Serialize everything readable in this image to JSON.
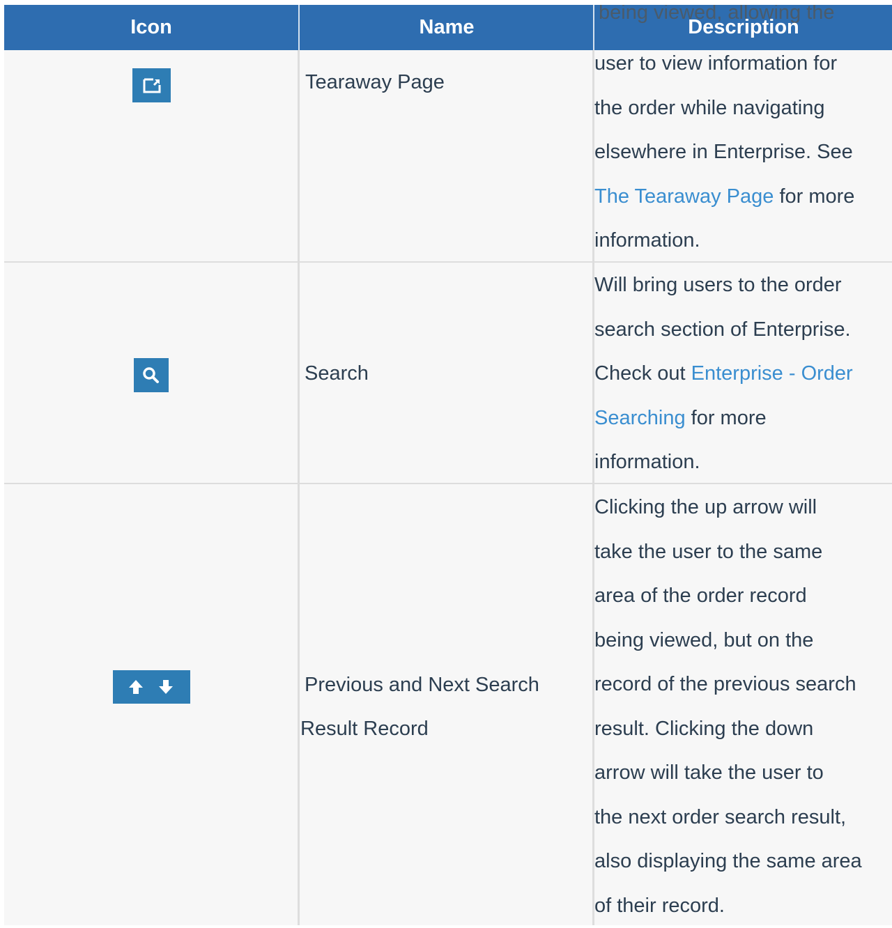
{
  "header": {
    "col_icon": "Icon",
    "col_name": "Name",
    "col_desc": "Description"
  },
  "row1": {
    "icon": "tearaway-icon",
    "name": "Tearaway Page",
    "desc_overflow": "being viewed, allowing the",
    "desc_lines": [
      "user to view information for",
      "the order while navigating",
      "elsewhere in Enterprise. See"
    ],
    "desc_link": "The Tearaway Page",
    "desc_after_link": " for more",
    "desc_last": "information."
  },
  "row2": {
    "icon": "search-icon",
    "name": "Search",
    "desc_l1": "Will bring users to the order",
    "desc_l2": "search section of Enterprise.",
    "desc_l3_pre": "Check out ",
    "desc_l3_link": "Enterprise - Order",
    "desc_l4_link": "Searching",
    "desc_l4_post": " for more",
    "desc_l5": "information."
  },
  "row3": {
    "icon": "up-down-arrows-icon",
    "name_l1": "Previous and Next Search",
    "name_l2": "Result Record",
    "desc_lines": [
      "Clicking the up arrow will",
      "take the user to the same",
      "area of the order record",
      "being viewed, but on the",
      "record of the previous search",
      "result. Clicking the down",
      "arrow will take the user to",
      "the next order search result,",
      "also displaying the same area",
      "of their record."
    ]
  },
  "colors": {
    "header_bg": "#2e6db0",
    "link": "#3a8ed0",
    "icon_bg": "#2e7db4",
    "row_bg": "#f7f7f7",
    "border": "#dddddd"
  }
}
